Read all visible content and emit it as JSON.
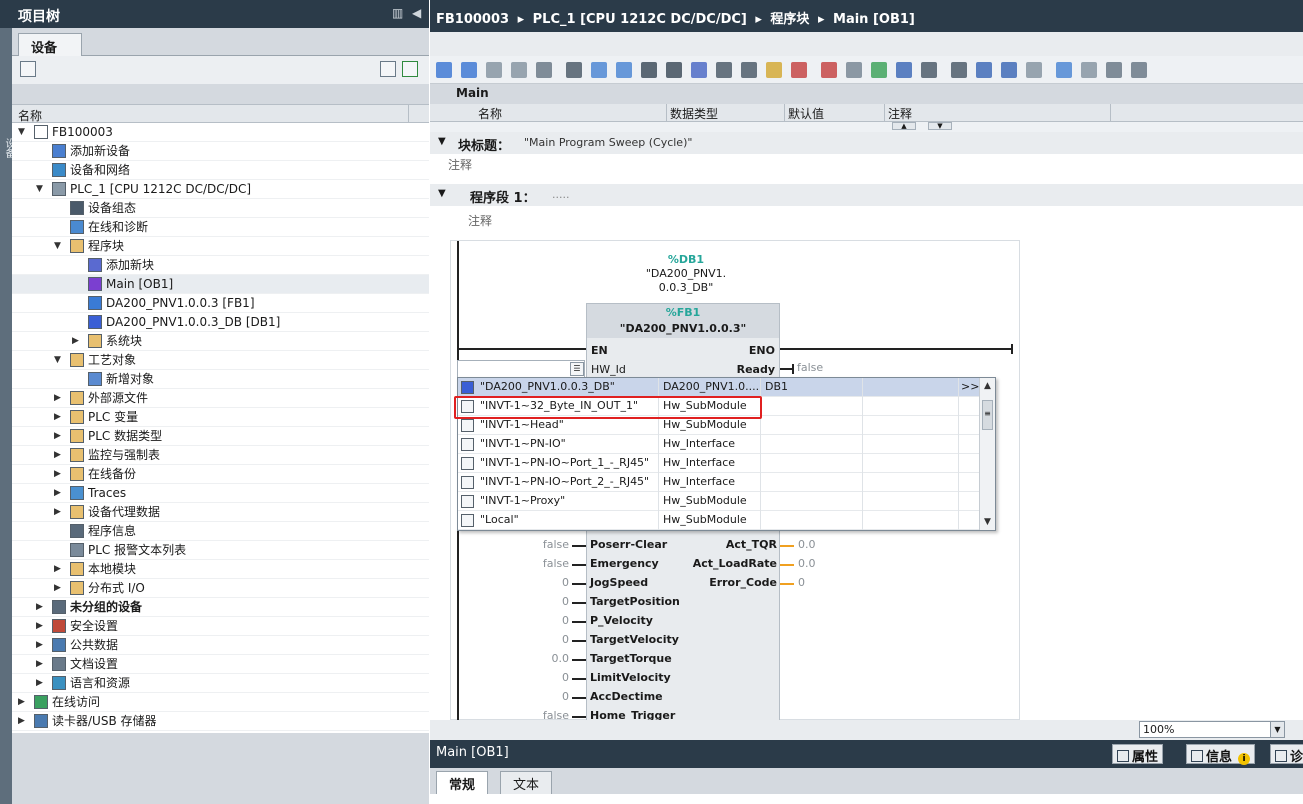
{
  "left_panel": {
    "title": "项目树",
    "tab_devices": "设备",
    "column_name": "名称",
    "side_strip_label": "设备",
    "tree": [
      {
        "label": "FB100003",
        "level": 0,
        "expanded": true,
        "icon": "project-icon",
        "bold": false
      },
      {
        "label": "添加新设备",
        "level": 1,
        "icon": "add-device-icon"
      },
      {
        "label": "设备和网络",
        "level": 1,
        "icon": "network-icon"
      },
      {
        "label": "PLC_1 [CPU 1212C DC/DC/DC]",
        "level": 1,
        "expanded": true,
        "icon": "plc-icon"
      },
      {
        "label": "设备组态",
        "level": 2,
        "icon": "device-config-icon"
      },
      {
        "label": "在线和诊断",
        "level": 2,
        "icon": "online-diag-icon"
      },
      {
        "label": "程序块",
        "level": 2,
        "expanded": true,
        "icon": "folder-icon"
      },
      {
        "label": "添加新块",
        "level": 3,
        "icon": "add-block-icon"
      },
      {
        "label": "Main [OB1]",
        "level": 3,
        "icon": "ob-icon",
        "selected": true
      },
      {
        "label": "DA200_PNV1.0.0.3 [FB1]",
        "level": 3,
        "icon": "fb-icon"
      },
      {
        "label": "DA200_PNV1.0.0.3_DB [DB1]",
        "level": 3,
        "icon": "db-icon"
      },
      {
        "label": "系统块",
        "level": 3,
        "collapsed": true,
        "icon": "folder-icon"
      },
      {
        "label": "工艺对象",
        "level": 2,
        "expanded": true,
        "icon": "folder-icon"
      },
      {
        "label": "新增对象",
        "level": 3,
        "icon": "add-object-icon"
      },
      {
        "label": "外部源文件",
        "level": 2,
        "collapsed": true,
        "icon": "folder-icon"
      },
      {
        "label": "PLC 变量",
        "level": 2,
        "collapsed": true,
        "icon": "folder-icon"
      },
      {
        "label": "PLC 数据类型",
        "level": 2,
        "collapsed": true,
        "icon": "folder-icon"
      },
      {
        "label": "监控与强制表",
        "level": 2,
        "collapsed": true,
        "icon": "folder-icon"
      },
      {
        "label": "在线备份",
        "level": 2,
        "collapsed": true,
        "icon": "folder-icon"
      },
      {
        "label": "Traces",
        "level": 2,
        "collapsed": true,
        "icon": "traces-icon"
      },
      {
        "label": "设备代理数据",
        "level": 2,
        "collapsed": true,
        "icon": "folder-icon"
      },
      {
        "label": "程序信息",
        "level": 2,
        "icon": "program-info-icon"
      },
      {
        "label": "PLC 报警文本列表",
        "level": 2,
        "icon": "alarm-text-icon"
      },
      {
        "label": "本地模块",
        "level": 2,
        "collapsed": true,
        "icon": "folder-icon"
      },
      {
        "label": "分布式 I/O",
        "level": 2,
        "collapsed": true,
        "icon": "folder-icon"
      },
      {
        "label": "未分组的设备",
        "level": 1,
        "collapsed": true,
        "icon": "ungrouped-icon",
        "bold": true
      },
      {
        "label": "安全设置",
        "level": 1,
        "collapsed": true,
        "icon": "security-icon"
      },
      {
        "label": "公共数据",
        "level": 1,
        "collapsed": true,
        "icon": "common-data-icon"
      },
      {
        "label": "文档设置",
        "level": 1,
        "collapsed": true,
        "icon": "doc-settings-icon"
      },
      {
        "label": "语言和资源",
        "level": 1,
        "collapsed": true,
        "icon": "language-icon"
      },
      {
        "label": "在线访问",
        "level": 0,
        "collapsed": true,
        "icon": "online-access-icon"
      },
      {
        "label": "读卡器/USB 存储器",
        "level": 0,
        "collapsed": true,
        "icon": "card-reader-icon"
      }
    ]
  },
  "right_panel": {
    "breadcrumb": [
      "FB100003",
      "PLC_1 [CPU 1212C DC/DC/DC]",
      "程序块",
      "Main [OB1]"
    ],
    "interface_header": "Main",
    "interface_columns": [
      "名称",
      "数据类型",
      "默认值",
      "注释"
    ],
    "block_title_label": "块标题：",
    "block_title_value": "\"Main Program Sweep (Cycle)\"",
    "comment_label": "注释",
    "network_label": "程序段 1：",
    "network_value": ".....",
    "network_comment": "注释",
    "db_tag": "%DB1",
    "db_name_line1": "\"DA200_PNV1.",
    "db_name_line2": "0.0.3_DB\"",
    "fb_tag": "%FB1",
    "fb_name": "\"DA200_PNV1.0.0.3\"",
    "pins": {
      "en": "EN",
      "eno": "ENO",
      "hw_id": "HW_Id",
      "ready": "Ready",
      "ready_val": "false",
      "inputs": [
        {
          "name": "Poserr-Clear",
          "val": "false"
        },
        {
          "name": "Emergency",
          "val": "false"
        },
        {
          "name": "JogSpeed",
          "val": "0"
        },
        {
          "name": "TargetPosition",
          "val": "0"
        },
        {
          "name": "P_Velocity",
          "val": "0"
        },
        {
          "name": "TargetVelocity",
          "val": "0"
        },
        {
          "name": "TargetTorque",
          "val": "0.0"
        },
        {
          "name": "LimitVelocity",
          "val": "0"
        },
        {
          "name": "AccDectime",
          "val": "0"
        },
        {
          "name": "Home_Trigger",
          "val": "false"
        }
      ],
      "outputs": [
        {
          "name": "Act_TQR",
          "val": "0.0"
        },
        {
          "name": "Act_LoadRate",
          "val": "0.0"
        },
        {
          "name": "Error_Code",
          "val": "0"
        }
      ]
    },
    "dropdown": [
      {
        "name": "\"DA200_PNV1.0.0.3_DB\"",
        "type": "DA200_PNV1.0....",
        "addr": "DB1",
        "more": ">>",
        "icon": "db-icon",
        "highlight": true
      },
      {
        "name": "\"INVT-1~32_Byte_IN_OUT_1\"",
        "type": "Hw_SubModule",
        "addr": "",
        "icon": "hw-tag-icon"
      },
      {
        "name": "\"INVT-1~Head\"",
        "type": "Hw_SubModule",
        "addr": "",
        "icon": "hw-tag-icon"
      },
      {
        "name": "\"INVT-1~PN-IO\"",
        "type": "Hw_Interface",
        "addr": "",
        "icon": "hw-tag-icon"
      },
      {
        "name": "\"INVT-1~PN-IO~Port_1_-_RJ45\"",
        "type": "Hw_Interface",
        "addr": "",
        "icon": "hw-tag-icon"
      },
      {
        "name": "\"INVT-1~PN-IO~Port_2_-_RJ45\"",
        "type": "Hw_Interface",
        "addr": "",
        "icon": "hw-tag-icon"
      },
      {
        "name": "\"INVT-1~Proxy\"",
        "type": "Hw_SubModule",
        "addr": "",
        "icon": "hw-tag-icon"
      },
      {
        "name": "\"Local\"",
        "type": "Hw_SubModule",
        "addr": "",
        "icon": "hw-tag-icon"
      }
    ],
    "zoom": "100%",
    "inspector_title": "Main [OB1]",
    "inspector_tabs": [
      "属性",
      "信息",
      "诊"
    ],
    "bottom_tabs": [
      "常规",
      "文本"
    ]
  },
  "colors": {
    "title_bar": "#2b3b49",
    "accent_tag": "#26a69a",
    "highlight_box": "#e02020",
    "selection": "#c9d5ea"
  }
}
